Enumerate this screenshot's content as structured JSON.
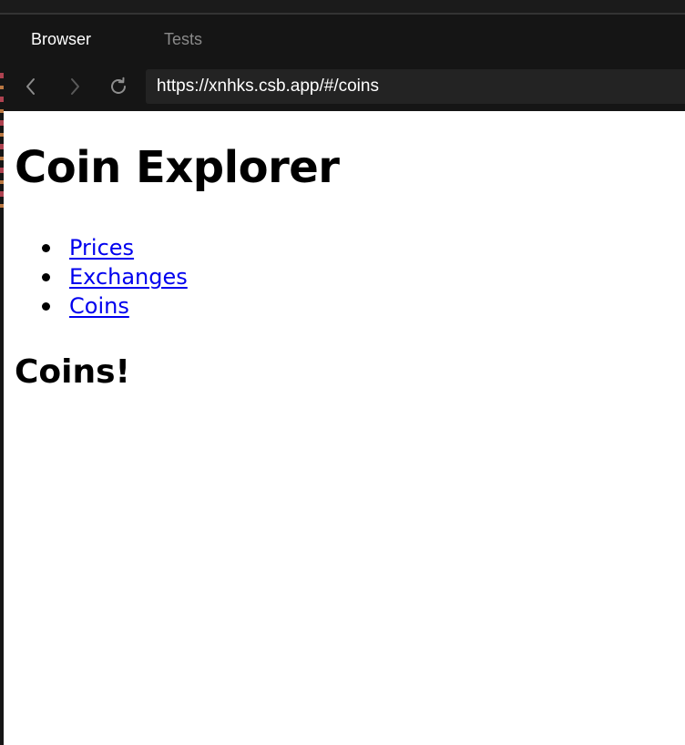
{
  "browser": {
    "tabs": [
      {
        "label": "Browser",
        "active": true
      },
      {
        "label": "Tests",
        "active": false
      }
    ],
    "url": "https://xnhks.csb.app/#/coins",
    "icons": {
      "back": "chevron-left-icon",
      "forward": "chevron-right-icon",
      "reload": "reload-icon"
    }
  },
  "page": {
    "title": "Coin Explorer",
    "nav": [
      {
        "label": "Prices"
      },
      {
        "label": "Exchanges"
      },
      {
        "label": "Coins"
      }
    ],
    "heading": "Coins!"
  },
  "colors": {
    "chrome_bg": "#151515",
    "url_bg": "#232323",
    "link": "#0000ee",
    "page_bg": "#ffffff"
  }
}
